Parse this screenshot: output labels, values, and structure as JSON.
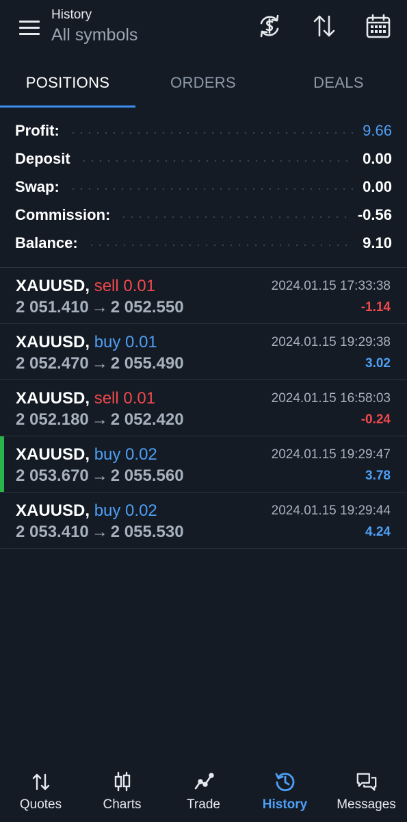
{
  "header": {
    "title": "History",
    "subtitle": "All symbols",
    "icons": [
      "currency-exchange-icon",
      "sort-icon",
      "calendar-icon"
    ]
  },
  "tabs": [
    "POSITIONS",
    "ORDERS",
    "DEALS"
  ],
  "active_tab": "POSITIONS",
  "summary": [
    {
      "label": "Profit:",
      "value": "9.66"
    },
    {
      "label": "Deposit",
      "value": "0.00"
    },
    {
      "label": "Swap:",
      "value": "0.00"
    },
    {
      "label": "Commission:",
      "value": "-0.56"
    },
    {
      "label": "Balance:",
      "value": "9.10"
    }
  ],
  "positions": [
    {
      "symbol": "XAUUSD, ",
      "side": "sell 0.01",
      "open": "2 051.410",
      "close": "2 052.550",
      "time": "2024.01.15 17:33:38",
      "profit": "-1.14"
    },
    {
      "symbol": "XAUUSD, ",
      "side": "buy 0.01",
      "open": "2 052.470",
      "close": "2 055.490",
      "time": "2024.01.15 19:29:38",
      "profit": "3.02"
    },
    {
      "symbol": "XAUUSD, ",
      "side": "sell 0.01",
      "open": "2 052.180",
      "close": "2 052.420",
      "time": "2024.01.15 16:58:03",
      "profit": "-0.24"
    },
    {
      "symbol": "XAUUSD, ",
      "side": "buy 0.02",
      "open": "2 053.670",
      "close": "2 055.560",
      "time": "2024.01.15 19:29:47",
      "profit": "3.78"
    },
    {
      "symbol": "XAUUSD, ",
      "side": "buy 0.02",
      "open": "2 053.410",
      "close": "2 055.530",
      "time": "2024.01.15 19:29:44",
      "profit": "4.24"
    }
  ],
  "nav": [
    {
      "label": "Quotes",
      "icon": "quotes-icon"
    },
    {
      "label": "Charts",
      "icon": "candlestick-chart-icon"
    },
    {
      "label": "Trade",
      "icon": "trade-line-icon"
    },
    {
      "label": "History",
      "icon": "history-clock-icon"
    },
    {
      "label": "Messages",
      "icon": "messages-icon"
    }
  ],
  "active_nav": "History",
  "colors": {
    "background": "#141b25",
    "accent_blue": "#4e9ff5",
    "sell_red": "#f0484b",
    "marker_green": "#28b44a",
    "muted_text": "#a7b1be"
  }
}
